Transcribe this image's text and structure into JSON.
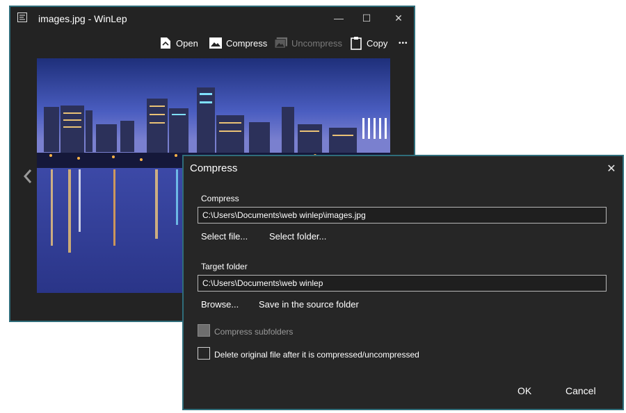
{
  "main_window": {
    "title": "images.jpg - WinLep",
    "controls": {
      "minimize": "—",
      "maximize": "☐",
      "close": "✕"
    },
    "toolbar": {
      "open": "Open",
      "compress": "Compress",
      "uncompress": "Uncompress",
      "copy": "Copy",
      "more": "•••"
    }
  },
  "dialog": {
    "title": "Compress",
    "compress_label": "Compress",
    "compress_path": "C:\\Users\\Documents\\web winlep\\images.jpg",
    "select_file": "Select file...",
    "select_folder": "Select folder...",
    "target_label": "Target folder",
    "target_path": "C:\\Users\\Documents\\web winlep",
    "browse": "Browse...",
    "save_in_source": "Save in the source folder",
    "compress_subfolders": "Compress subfolders",
    "delete_original": "Delete original file after it is compressed/uncompressed",
    "ok": "OK",
    "cancel": "Cancel"
  },
  "colors": {
    "window_bg": "#232323",
    "dialog_bg": "#262626",
    "border_accent": "#2f6d7a",
    "disabled_text": "#7a7a7a"
  }
}
